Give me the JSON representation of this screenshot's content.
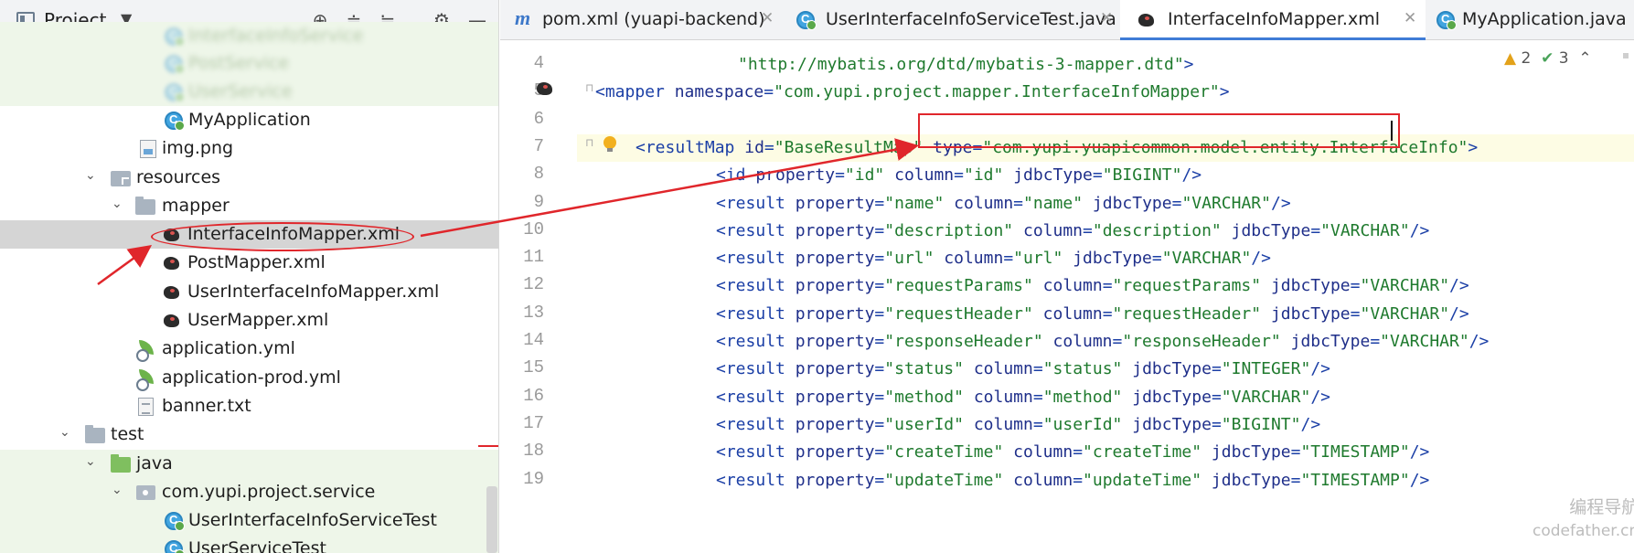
{
  "project_panel": {
    "title": "Project",
    "header_icons": [
      "crosshair-icon",
      "expand-all-icon",
      "collapse-all-icon",
      "gear-icon",
      "minimize-icon"
    ],
    "tree": [
      {
        "label": "InterfaceInfoService",
        "icon": "class-icon",
        "blurred": true
      },
      {
        "label": "PostService",
        "icon": "class-icon",
        "blurred": true
      },
      {
        "label": "UserService",
        "icon": "class-icon",
        "blurred": true
      },
      {
        "label": "MyApplication",
        "icon": "class-icon"
      },
      {
        "label": "img.png",
        "icon": "image-file-icon"
      },
      {
        "label": "resources",
        "icon": "resources-folder-icon",
        "expanded": true
      },
      {
        "label": "mapper",
        "icon": "folder-icon",
        "expanded": true
      },
      {
        "label": "InterfaceInfoMapper.xml",
        "icon": "mybatis-xml-icon",
        "selected": true
      },
      {
        "label": "PostMapper.xml",
        "icon": "mybatis-xml-icon"
      },
      {
        "label": "UserInterfaceInfoMapper.xml",
        "icon": "mybatis-xml-icon"
      },
      {
        "label": "UserMapper.xml",
        "icon": "mybatis-xml-icon"
      },
      {
        "label": "application.yml",
        "icon": "yaml-file-icon"
      },
      {
        "label": "application-prod.yml",
        "icon": "yaml-file-icon"
      },
      {
        "label": "banner.txt",
        "icon": "text-file-icon"
      },
      {
        "label": "test",
        "icon": "folder-icon",
        "expanded": true
      },
      {
        "label": "java",
        "icon": "test-folder-icon",
        "expanded": true
      },
      {
        "label": "com.yupi.project.service",
        "icon": "package-icon",
        "expanded": true
      },
      {
        "label": "UserInterfaceInfoServiceTest",
        "icon": "class-icon"
      },
      {
        "label": "UserServiceTest",
        "icon": "class-icon"
      }
    ]
  },
  "tabs": [
    {
      "label": "pom.xml (yuapi-backend)",
      "icon": "maven-icon"
    },
    {
      "label": "UserInterfaceInfoServiceTest.java",
      "icon": "class-icon"
    },
    {
      "label": "InterfaceInfoMapper.xml",
      "icon": "mybatis-xml-icon",
      "active": true
    },
    {
      "label": "MyApplication.java",
      "icon": "class-icon"
    }
  ],
  "inspections": {
    "warnings": "2",
    "passed": "3"
  },
  "code_lines": [
    {
      "n": "4",
      "tokens": [
        [
          "str",
          "\"http://mybatis.org/dtd/mybatis-3-mapper.dtd\""
        ],
        [
          "punc",
          ">"
        ]
      ]
    },
    {
      "n": "5",
      "tokens": [
        [
          "punc",
          "<"
        ],
        [
          "tag",
          "mapper"
        ],
        [
          "plain",
          " "
        ],
        [
          "attr",
          "namespace"
        ],
        [
          "punc",
          "="
        ],
        [
          "str",
          "\"com.yupi.project.mapper.InterfaceInfoMapper\""
        ],
        [
          "punc",
          ">"
        ]
      ]
    },
    {
      "n": "6",
      "tokens": []
    },
    {
      "n": "7",
      "tokens": [
        [
          "punc",
          "<"
        ],
        [
          "tag",
          "resultMap"
        ],
        [
          "plain",
          " "
        ],
        [
          "attr",
          "id"
        ],
        [
          "punc",
          "="
        ],
        [
          "str",
          "\"BaseResultMap\""
        ],
        [
          "plain",
          " "
        ],
        [
          "attr",
          "type"
        ],
        [
          "punc",
          "="
        ],
        [
          "str",
          "\"com.yupi.yuapicommon.model.entity.InterfaceInfo\""
        ],
        [
          "punc",
          ">"
        ]
      ]
    },
    {
      "n": "8",
      "tokens": [
        [
          "punc",
          "<"
        ],
        [
          "tag",
          "id"
        ],
        [
          "plain",
          " "
        ],
        [
          "attr",
          "property"
        ],
        [
          "punc",
          "="
        ],
        [
          "str",
          "\"id\""
        ],
        [
          "plain",
          " "
        ],
        [
          "attr",
          "column"
        ],
        [
          "punc",
          "="
        ],
        [
          "str",
          "\"id\""
        ],
        [
          "plain",
          " "
        ],
        [
          "attr",
          "jdbcType"
        ],
        [
          "punc",
          "="
        ],
        [
          "str",
          "\"BIGINT\""
        ],
        [
          "punc",
          "/>"
        ]
      ]
    },
    {
      "n": "9",
      "tokens": [
        [
          "punc",
          "<"
        ],
        [
          "tag",
          "result"
        ],
        [
          "plain",
          " "
        ],
        [
          "attr",
          "property"
        ],
        [
          "punc",
          "="
        ],
        [
          "str",
          "\"name\""
        ],
        [
          "plain",
          " "
        ],
        [
          "attr",
          "column"
        ],
        [
          "punc",
          "="
        ],
        [
          "str",
          "\"name\""
        ],
        [
          "plain",
          " "
        ],
        [
          "attr",
          "jdbcType"
        ],
        [
          "punc",
          "="
        ],
        [
          "str",
          "\"VARCHAR\""
        ],
        [
          "punc",
          "/>"
        ]
      ]
    },
    {
      "n": "10",
      "tokens": [
        [
          "punc",
          "<"
        ],
        [
          "tag",
          "result"
        ],
        [
          "plain",
          " "
        ],
        [
          "attr",
          "property"
        ],
        [
          "punc",
          "="
        ],
        [
          "str",
          "\"description\""
        ],
        [
          "plain",
          " "
        ],
        [
          "attr",
          "column"
        ],
        [
          "punc",
          "="
        ],
        [
          "str",
          "\"description\""
        ],
        [
          "plain",
          " "
        ],
        [
          "attr",
          "jdbcType"
        ],
        [
          "punc",
          "="
        ],
        [
          "str",
          "\"VARCHAR\""
        ],
        [
          "punc",
          "/>"
        ]
      ]
    },
    {
      "n": "11",
      "tokens": [
        [
          "punc",
          "<"
        ],
        [
          "tag",
          "result"
        ],
        [
          "plain",
          " "
        ],
        [
          "attr",
          "property"
        ],
        [
          "punc",
          "="
        ],
        [
          "str",
          "\"url\""
        ],
        [
          "plain",
          " "
        ],
        [
          "attr",
          "column"
        ],
        [
          "punc",
          "="
        ],
        [
          "str",
          "\"url\""
        ],
        [
          "plain",
          " "
        ],
        [
          "attr",
          "jdbcType"
        ],
        [
          "punc",
          "="
        ],
        [
          "str",
          "\"VARCHAR\""
        ],
        [
          "punc",
          "/>"
        ]
      ]
    },
    {
      "n": "12",
      "tokens": [
        [
          "punc",
          "<"
        ],
        [
          "tag",
          "result"
        ],
        [
          "plain",
          " "
        ],
        [
          "attr",
          "property"
        ],
        [
          "punc",
          "="
        ],
        [
          "str",
          "\"requestParams\""
        ],
        [
          "plain",
          " "
        ],
        [
          "attr",
          "column"
        ],
        [
          "punc",
          "="
        ],
        [
          "str",
          "\"requestParams\""
        ],
        [
          "plain",
          " "
        ],
        [
          "attr",
          "jdbcType"
        ],
        [
          "punc",
          "="
        ],
        [
          "str",
          "\"VARCHAR\""
        ],
        [
          "punc",
          "/>"
        ]
      ]
    },
    {
      "n": "13",
      "tokens": [
        [
          "punc",
          "<"
        ],
        [
          "tag",
          "result"
        ],
        [
          "plain",
          " "
        ],
        [
          "attr",
          "property"
        ],
        [
          "punc",
          "="
        ],
        [
          "str",
          "\"requestHeader\""
        ],
        [
          "plain",
          " "
        ],
        [
          "attr",
          "column"
        ],
        [
          "punc",
          "="
        ],
        [
          "str",
          "\"requestHeader\""
        ],
        [
          "plain",
          " "
        ],
        [
          "attr",
          "jdbcType"
        ],
        [
          "punc",
          "="
        ],
        [
          "str",
          "\"VARCHAR\""
        ],
        [
          "punc",
          "/>"
        ]
      ]
    },
    {
      "n": "14",
      "tokens": [
        [
          "punc",
          "<"
        ],
        [
          "tag",
          "result"
        ],
        [
          "plain",
          " "
        ],
        [
          "attr",
          "property"
        ],
        [
          "punc",
          "="
        ],
        [
          "str",
          "\"responseHeader\""
        ],
        [
          "plain",
          " "
        ],
        [
          "attr",
          "column"
        ],
        [
          "punc",
          "="
        ],
        [
          "str",
          "\"responseHeader\""
        ],
        [
          "plain",
          " "
        ],
        [
          "attr",
          "jdbcType"
        ],
        [
          "punc",
          "="
        ],
        [
          "str",
          "\"VARCHAR\""
        ],
        [
          "punc",
          "/>"
        ]
      ]
    },
    {
      "n": "15",
      "tokens": [
        [
          "punc",
          "<"
        ],
        [
          "tag",
          "result"
        ],
        [
          "plain",
          " "
        ],
        [
          "attr",
          "property"
        ],
        [
          "punc",
          "="
        ],
        [
          "str",
          "\"status\""
        ],
        [
          "plain",
          " "
        ],
        [
          "attr",
          "column"
        ],
        [
          "punc",
          "="
        ],
        [
          "str",
          "\"status\""
        ],
        [
          "plain",
          " "
        ],
        [
          "attr",
          "jdbcType"
        ],
        [
          "punc",
          "="
        ],
        [
          "str",
          "\"INTEGER\""
        ],
        [
          "punc",
          "/>"
        ]
      ]
    },
    {
      "n": "16",
      "tokens": [
        [
          "punc",
          "<"
        ],
        [
          "tag",
          "result"
        ],
        [
          "plain",
          " "
        ],
        [
          "attr",
          "property"
        ],
        [
          "punc",
          "="
        ],
        [
          "str",
          "\"method\""
        ],
        [
          "plain",
          " "
        ],
        [
          "attr",
          "column"
        ],
        [
          "punc",
          "="
        ],
        [
          "str",
          "\"method\""
        ],
        [
          "plain",
          " "
        ],
        [
          "attr",
          "jdbcType"
        ],
        [
          "punc",
          "="
        ],
        [
          "str",
          "\"VARCHAR\""
        ],
        [
          "punc",
          "/>"
        ]
      ]
    },
    {
      "n": "17",
      "tokens": [
        [
          "punc",
          "<"
        ],
        [
          "tag",
          "result"
        ],
        [
          "plain",
          " "
        ],
        [
          "attr",
          "property"
        ],
        [
          "punc",
          "="
        ],
        [
          "str",
          "\"userId\""
        ],
        [
          "plain",
          " "
        ],
        [
          "attr",
          "column"
        ],
        [
          "punc",
          "="
        ],
        [
          "str",
          "\"userId\""
        ],
        [
          "plain",
          " "
        ],
        [
          "attr",
          "jdbcType"
        ],
        [
          "punc",
          "="
        ],
        [
          "str",
          "\"BIGINT\""
        ],
        [
          "punc",
          "/>"
        ]
      ]
    },
    {
      "n": "18",
      "tokens": [
        [
          "punc",
          "<"
        ],
        [
          "tag",
          "result"
        ],
        [
          "plain",
          " "
        ],
        [
          "attr",
          "property"
        ],
        [
          "punc",
          "="
        ],
        [
          "str",
          "\"createTime\""
        ],
        [
          "plain",
          " "
        ],
        [
          "attr",
          "column"
        ],
        [
          "punc",
          "="
        ],
        [
          "str",
          "\"createTime\""
        ],
        [
          "plain",
          " "
        ],
        [
          "attr",
          "jdbcType"
        ],
        [
          "punc",
          "="
        ],
        [
          "str",
          "\"TIMESTAMP\""
        ],
        [
          "punc",
          "/>"
        ]
      ]
    },
    {
      "n": "19",
      "tokens": [
        [
          "punc",
          "<"
        ],
        [
          "tag",
          "result"
        ],
        [
          "plain",
          " "
        ],
        [
          "attr",
          "property"
        ],
        [
          "punc",
          "="
        ],
        [
          "str",
          "\"updateTime\""
        ],
        [
          "plain",
          " "
        ],
        [
          "attr",
          "column"
        ],
        [
          "punc",
          "="
        ],
        [
          "str",
          "\"updateTime\""
        ],
        [
          "plain",
          " "
        ],
        [
          "attr",
          "jdbcType"
        ],
        [
          "punc",
          "="
        ],
        [
          "str",
          "\"TIMESTAMP\""
        ],
        [
          "punc",
          "/>"
        ]
      ]
    }
  ],
  "watermark": {
    "line1": "编程导航",
    "line2": "codefather.cn"
  },
  "colors": {
    "annotation_red": "#e0262b",
    "tab_active_underline": "#3f7cd6",
    "string_green": "#1f7a2e",
    "tag_blue": "#1b3fa6"
  }
}
